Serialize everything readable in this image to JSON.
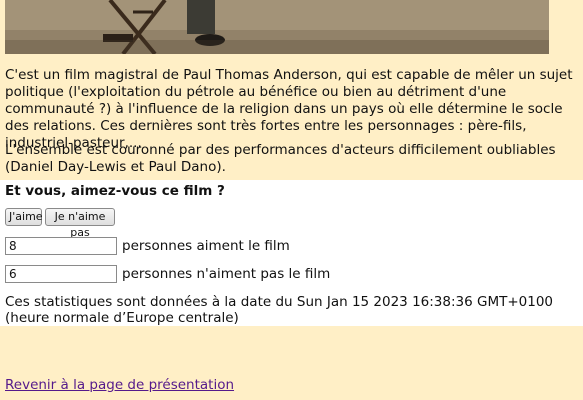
{
  "review": {
    "paragraph1": "C'est un film magistral de Paul Thomas Anderson, qui est capable de mêler un sujet politique (l'exploitation du pétrole au bénéfice ou bien au détriment d'une communauté ?) à l'influence de la religion dans un pays où elle détermine le socle des relations. Ces dernières sont très fortes entre les personnages : père-fils, industriel-pasteur,...",
    "paragraph2": "L'ensemble est couronné par des performances d'acteurs difficilement oubliables (Daniel Day-Lewis et Paul Dano)."
  },
  "poll": {
    "question": "Et vous, aimez-vous ce film ?",
    "like_button": "J'aime",
    "dislike_button": "Je n'aime pas",
    "like_count": "8",
    "like_label": "personnes aiment le film",
    "dislike_count": "6",
    "dislike_label": "personnes n'aiment pas le film",
    "stats_note": "Ces statistiques sont données à la date du Sun Jan 15 2023 16:38:36 GMT+0100 (heure normale d’Europe centrale)"
  },
  "footer": {
    "back_link": "Revenir à la page de présentation"
  }
}
